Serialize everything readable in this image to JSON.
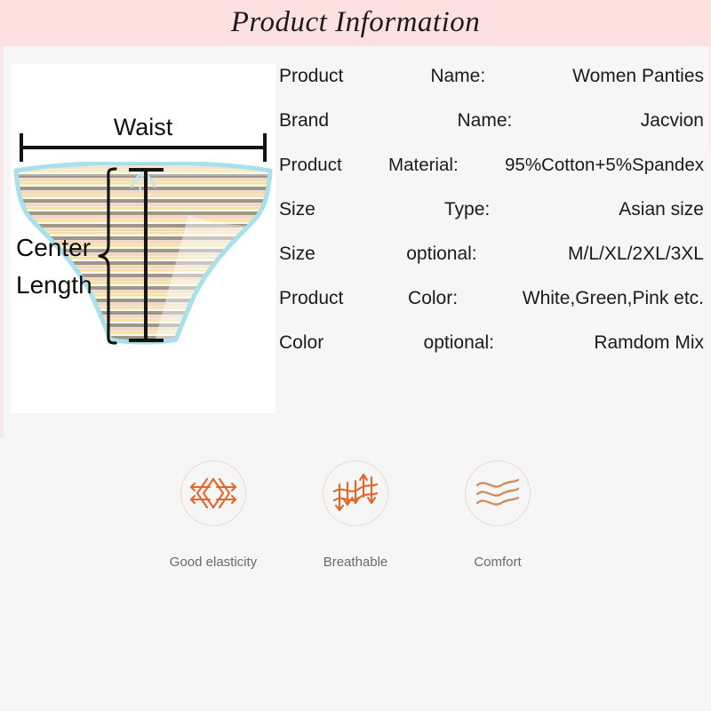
{
  "header": {
    "title": "Product Information"
  },
  "colors": {
    "header_band": "#fde1e1",
    "page_background": "#f6f6f6",
    "photo_background": "#ffffff",
    "icon_accent": "#e4672a",
    "icon_circle": "#e9b79a",
    "feature_label": "#6a6a6a",
    "garment_trim": "#a8e0ec",
    "garment_stripe_gray": "#8a8070",
    "garment_stripe_peach": "#f3d2bb",
    "garment_stripe_yellow": "#f2e08a",
    "garment_stripe_cream": "#f7f3ea",
    "annotation_line": "#141414"
  },
  "photo": {
    "alt": "striped women panties product photo",
    "annotations": {
      "waist_label": "Waist",
      "center_length_label_line1": "Center",
      "center_length_label_line2": "Length"
    }
  },
  "info_table": {
    "rows": [
      {
        "label": "Product",
        "field": "Name:",
        "value": "Women Panties"
      },
      {
        "label": "Brand",
        "field": "Name:",
        "value": "Jacvion"
      },
      {
        "label": "Product",
        "field": "Material:",
        "value": "95%Cotton+5%Spandex"
      },
      {
        "label": "Size",
        "field": "Type:",
        "value": "Asian size"
      },
      {
        "label": "Size",
        "field": "optional:",
        "value": "M/L/XL/2XL/3XL"
      },
      {
        "label": "Product",
        "field": "Color:",
        "value": "White,Green,Pink etc."
      },
      {
        "label": "Color",
        "field": "optional:",
        "value": "Ramdom Mix"
      }
    ]
  },
  "features": [
    {
      "label": "Good elasticity",
      "icon": "elasticity-arrows-icon"
    },
    {
      "label": "Breathable",
      "icon": "breathable-airflow-icon"
    },
    {
      "label": "Comfort",
      "icon": "comfort-waves-icon"
    }
  ]
}
